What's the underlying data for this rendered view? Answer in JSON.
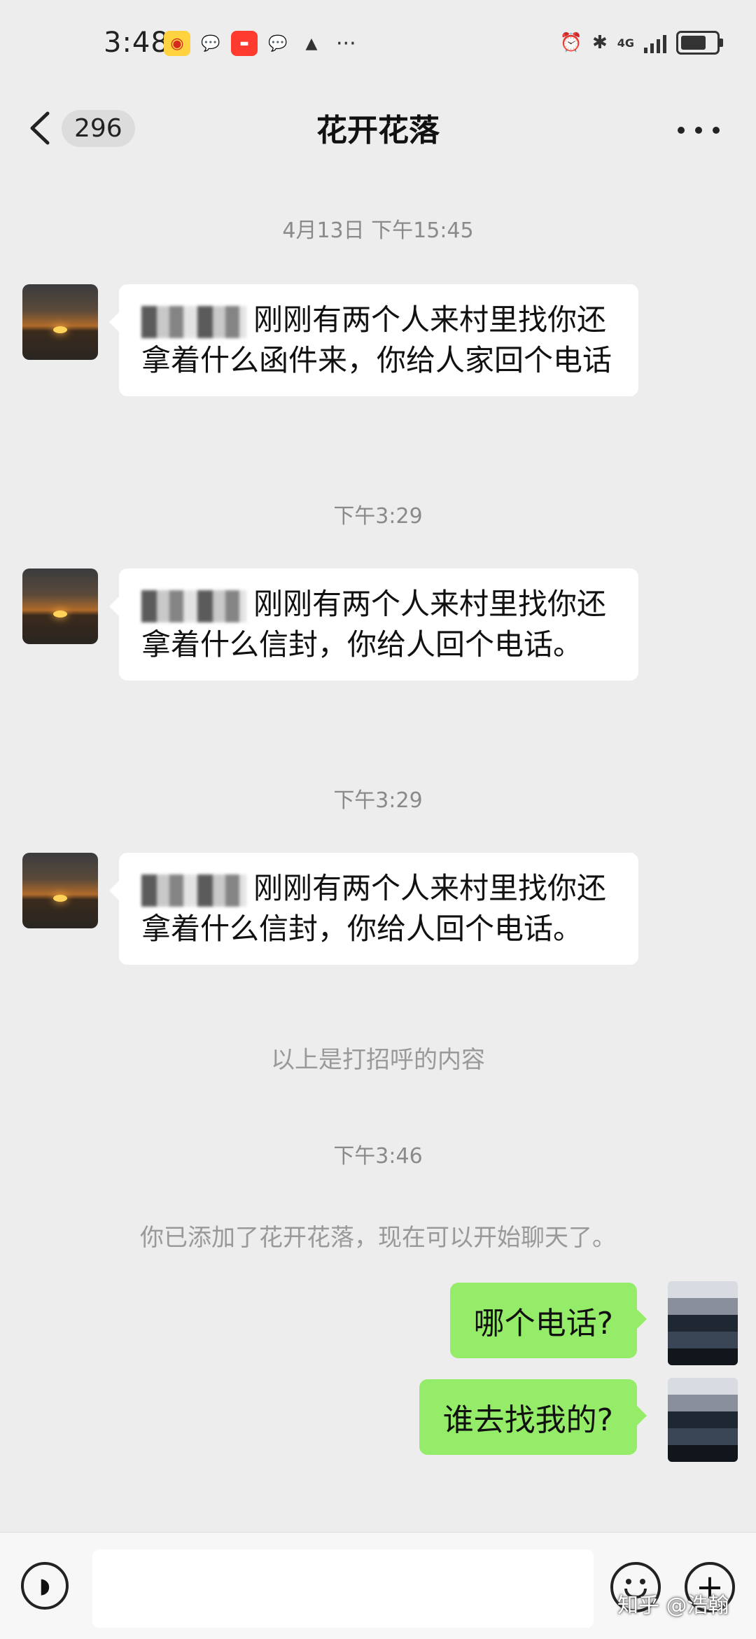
{
  "status_bar": {
    "time": "3:48",
    "more": "···",
    "network": "4G"
  },
  "header": {
    "back_count": "296",
    "title": "花开花落"
  },
  "messages": {
    "ts1": "4月13日 下午15:45",
    "m1": "刚刚有两个人来村里找你还拿着什么函件来，你给人家回个电话",
    "ts2": "下午3:29",
    "m2": "刚刚有两个人来村里找你还拿着什么信封，你给人回个电话。",
    "ts3": "下午3:29",
    "m3": "刚刚有两个人来村里找你还拿着什么信封，你给人回个电话。",
    "sys1": "以上是打招呼的内容",
    "ts4": "下午3:46",
    "sys2": "你已添加了花开花落，现在可以开始聊天了。",
    "out1": "哪个电话?",
    "out2": "谁去找我的?"
  },
  "input_bar": {
    "value": "",
    "plus": "+"
  },
  "watermark": "知乎 @浩翰",
  "colors": {
    "background": "#ededed",
    "bubble_in": "#ffffff",
    "bubble_out": "#95ec69"
  }
}
